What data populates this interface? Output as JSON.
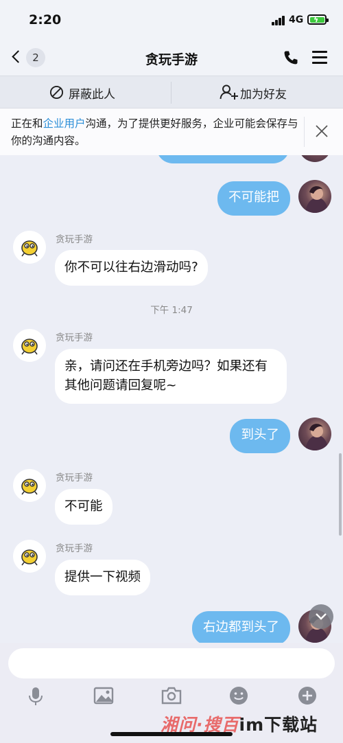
{
  "status_bar": {
    "time": "2:20",
    "network": "4G"
  },
  "nav": {
    "back_count": "2",
    "title": "贪玩手游"
  },
  "actions": {
    "block": "屏蔽此人",
    "add_friend": "加为好友"
  },
  "notice": {
    "prefix": "正在和",
    "link": "企业用户",
    "suffix": "沟通，为了提供更好服务，企业可能会保存与你的沟通内容。"
  },
  "messages": [
    {
      "from": "me",
      "text": "不可能把"
    },
    {
      "from": "bot",
      "sender": "贪玩手游",
      "text": "你不可以往右边滑动吗?"
    },
    {
      "type": "time",
      "text": "下午 1:47"
    },
    {
      "from": "bot",
      "sender": "贪玩手游",
      "text": "亲，请问还在手机旁边吗？如果还有其他问题请回复呢~"
    },
    {
      "from": "me",
      "text": "到头了"
    },
    {
      "from": "bot",
      "sender": "贪玩手游",
      "text": "不可能"
    },
    {
      "from": "bot",
      "sender": "贪玩手游",
      "text": "提供一下视频"
    },
    {
      "from": "me",
      "text": "右边都到头了"
    }
  ],
  "input": {
    "value": "",
    "placeholder": ""
  },
  "toolbar": {
    "icons": [
      "mic-icon",
      "image-icon",
      "camera-icon",
      "emoji-icon",
      "plus-icon"
    ]
  },
  "watermark": {
    "part_a": "湘问·搜百",
    "part_b": "im下载站"
  },
  "colors": {
    "outgoing_bubble": "#6db9ef",
    "incoming_bubble": "#ffffff",
    "link": "#2d8fd8",
    "background": "#eceef6"
  }
}
